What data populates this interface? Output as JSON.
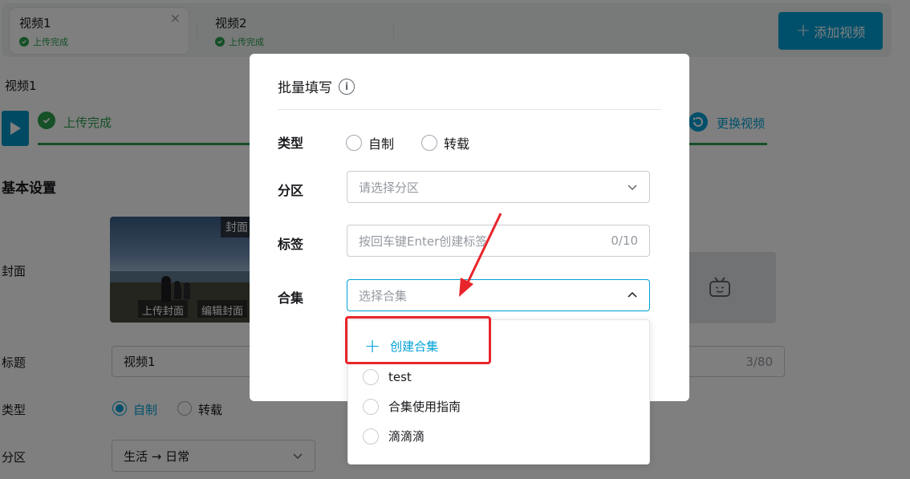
{
  "tabs": [
    {
      "name": "视频1",
      "status": "上传完成",
      "close": "×"
    },
    {
      "name": "视频2",
      "status": "上传完成"
    }
  ],
  "add_video_label": "添加视频",
  "file": {
    "title": "视频1",
    "upload_status": "上传完成",
    "replace_label": "更换视频",
    "progress_fraction": 1.0
  },
  "basic_settings": {
    "title": "基本设置",
    "cover_label": "封面",
    "cover_tag": "封面",
    "upload_cover": "上传封面",
    "edit_cover": "编辑封面",
    "title_label": "标题",
    "title_value": "视频1",
    "title_count": "3/80",
    "type_label": "类型",
    "type_options": [
      "自制",
      "转载"
    ],
    "type_selected": "自制",
    "zone_label": "分区",
    "zone_value": "生活 → 日常"
  },
  "modal": {
    "title": "批量填写",
    "info_icon": "i",
    "type_label": "类型",
    "type_options": [
      "自制",
      "转载"
    ],
    "zone_label": "分区",
    "zone_placeholder": "请选择分区",
    "tags_label": "标签",
    "tags_placeholder": "按回车键Enter创建标签",
    "tags_count": "0/10",
    "collection_label": "合集",
    "collection_placeholder": "选择合集"
  },
  "dropdown": {
    "create_label": "创建合集",
    "items": [
      "test",
      "合集使用指南",
      "滴滴滴"
    ]
  },
  "colors": {
    "accent": "#00a1d6",
    "success": "#2aa14d",
    "annotation_red": "#e8252b"
  }
}
